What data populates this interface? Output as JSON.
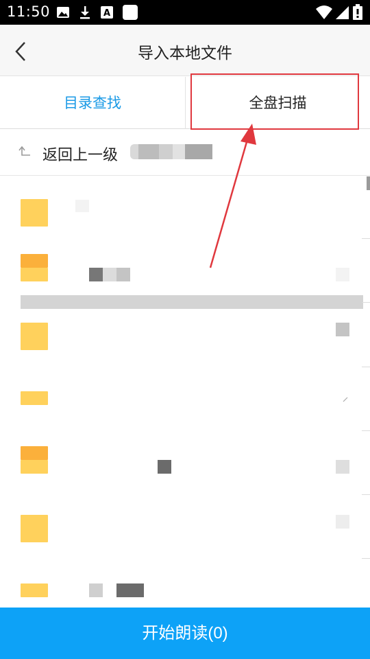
{
  "status_bar": {
    "time": "11:50",
    "left_icons": [
      "image-icon",
      "download-icon",
      "text-a-icon",
      "square-app-icon"
    ],
    "right_icons": [
      "wifi-icon",
      "signal-icon",
      "battery-icon"
    ]
  },
  "header": {
    "title": "导入本地文件",
    "back_icon": "chevron-left-icon"
  },
  "tabs": [
    {
      "label": "目录查找",
      "active": true,
      "color": "#1a9ae6"
    },
    {
      "label": "全盘扫描",
      "active": false
    }
  ],
  "navigation": {
    "up_label": "返回上一级",
    "up_icon": "level-up-icon"
  },
  "annotation": {
    "highlight_color": "#e0383e"
  },
  "colors": {
    "accent": "#0da2f7",
    "folder": "#ffd15c",
    "folder_tab": "#fbb03b"
  },
  "footer": {
    "start_reading_label": "开始朗读(0)"
  }
}
